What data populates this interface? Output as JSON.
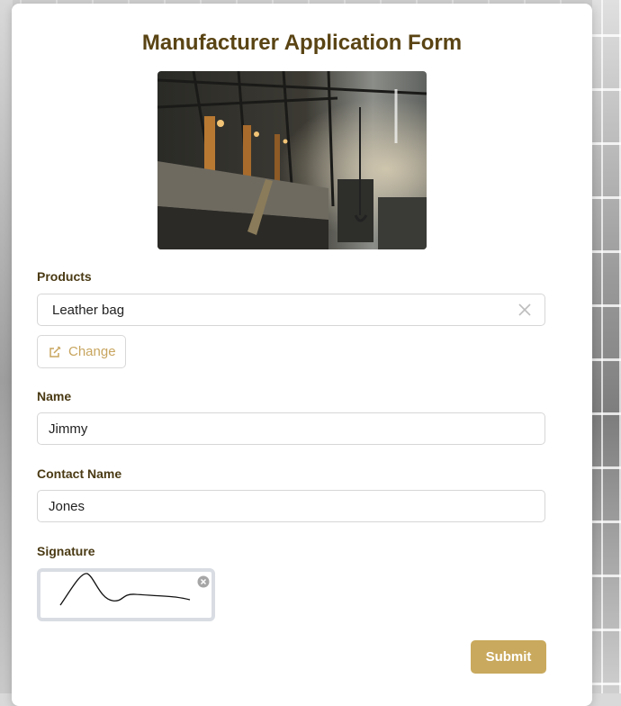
{
  "form": {
    "title": "Manufacturer Application Form",
    "products_label": "Products",
    "products_value": "Leather bag",
    "change_label": "Change",
    "name_label": "Name",
    "name_value": "Jimmy",
    "contact_label": "Contact Name",
    "contact_value": "Jones",
    "signature_label": "Signature",
    "submit_label": "Submit"
  },
  "colors": {
    "accent": "#c9a95d",
    "title": "#5a4414"
  },
  "icons": {
    "clear": "close-icon",
    "edit": "edit-icon",
    "signature_clear": "clear-circle-icon"
  }
}
